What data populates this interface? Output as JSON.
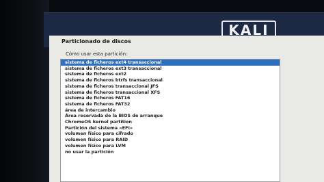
{
  "brand": {
    "logo_text": "KALI"
  },
  "page": {
    "title": "Particionado de discos"
  },
  "partition": {
    "prompt": "Cómo usar esta partición:",
    "selected_index": 0,
    "options": [
      "sistema de ficheros ext4 transaccional",
      "sistema de ficheros ext3 transaccional",
      "sistema de ficheros ext2",
      "sistema de ficheros btrfs transaccional",
      "sistema de ficheros transaccional JFS",
      "sistema de ficheros transaccional XFS",
      "sistema de ficheros FAT16",
      "sistema de ficheros FAT32",
      "área de intercambio",
      "Área reservada de la BIOS de arranque",
      "ChromeOS kernel partition",
      "Partición del sistema «EFI»",
      "volumen físico para cifrado",
      "volumen físico para RAID",
      "volumen físico para LVM",
      "no usar la partición"
    ]
  }
}
